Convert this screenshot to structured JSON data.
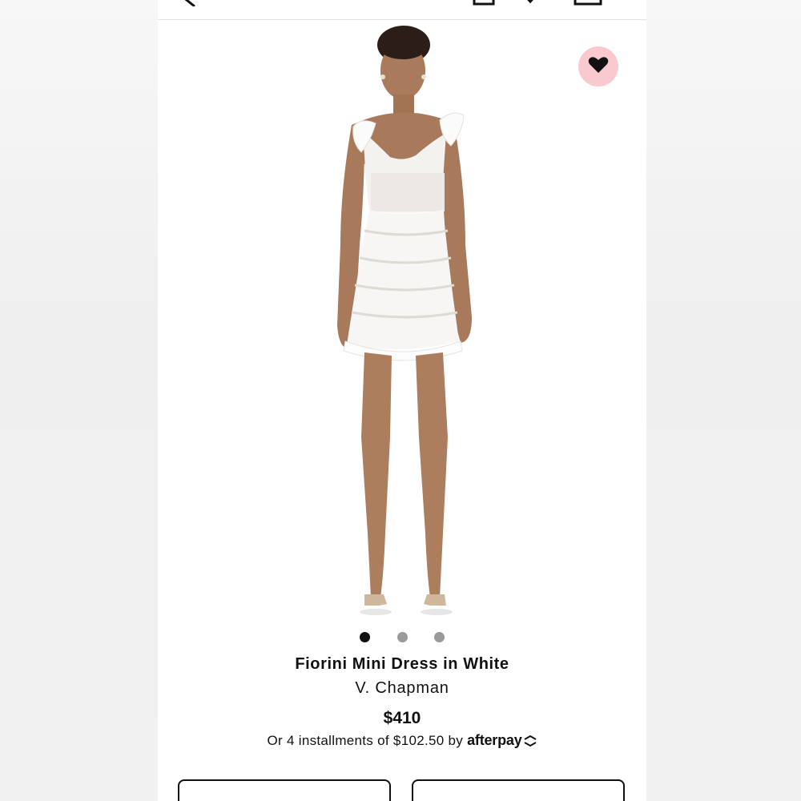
{
  "product": {
    "title": "Fiorini Mini Dress in White",
    "brand": "V. Chapman",
    "price": "$410",
    "installments_text": "Or 4 installments of $102.50 by",
    "installments_provider": "afterpay",
    "image_count": 3,
    "active_image": 1,
    "image_description_icon": "dress-photo"
  },
  "header": {
    "icons": [
      "back-icon",
      "account-icon",
      "heart-icon",
      "bag-icon"
    ]
  },
  "wishlist": {
    "icon": "heart-icon",
    "bg_color": "#f9c9cf"
  },
  "selectors": {
    "color_placeholder": "",
    "size_placeholder": ""
  },
  "colors": {
    "accent": "#111111",
    "wishlist_bg": "#f9c9cf",
    "dot_inactive": "#9a9a9a"
  }
}
